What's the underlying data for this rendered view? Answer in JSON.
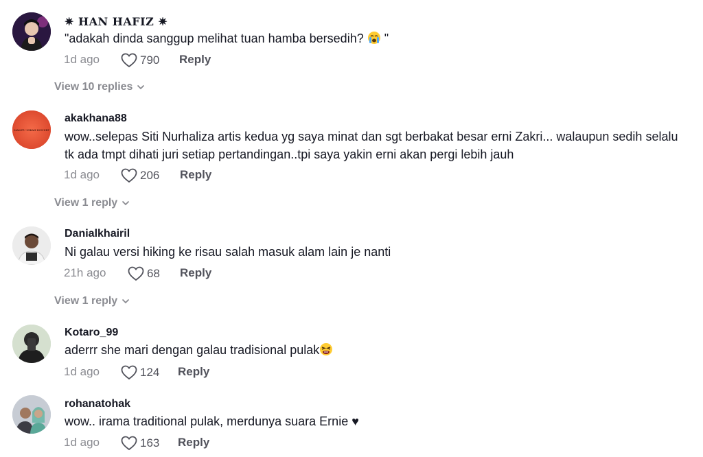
{
  "comments": [
    {
      "username": "✷ HAN HAFIZ ✷",
      "text": "\"adakah dinda sanggup melihat tuan hamba bersedih? ",
      "text_after": " \"",
      "emoji": "crying-face",
      "time": "1d ago",
      "likes": "790",
      "reply_label": "Reply",
      "view_replies": "View 10 replies",
      "avatar_colors": [
        "#3b1e5a",
        "#d94fb8"
      ]
    },
    {
      "username": "akakhana88",
      "text": "wow..selepas Siti Nurhaliza artis kedua yg saya minat dan sgt berbakat besar erni Zakri... walaupun sedih selalu tk ada tmpt dihati juri setiap pertandingan..tpi saya yakin erni akan pergi lebih jauh",
      "time": "1d ago",
      "likes": "206",
      "reply_label": "Reply",
      "view_replies": "View 1 reply",
      "avatar_text": "MAMPU NIKAH KONSEP",
      "avatar_colors": [
        "#d9442a",
        "#f25a3a"
      ]
    },
    {
      "username": "Danialkhairil",
      "text": "Ni galau versi hiking ke risau salah masuk alam lain je nanti",
      "time": "21h ago",
      "likes": "68",
      "reply_label": "Reply",
      "view_replies": "View 1 reply",
      "avatar_colors": [
        "#e8e8e8",
        "#3a2a22"
      ]
    },
    {
      "username": "Kotaro_99",
      "text": "aderrr she mari dengan galau tradisional pulak",
      "emoji": "tired-face",
      "time": "1d ago",
      "likes": "124",
      "reply_label": "Reply",
      "avatar_colors": [
        "#c9d7c2",
        "#2b2b2b"
      ]
    },
    {
      "username": "rohanatohak",
      "text": "wow.. irama traditional pulak, merdunya suara Ernie ♥",
      "time": "1d ago",
      "likes": "163",
      "reply_label": "Reply",
      "avatar_colors": [
        "#bfc7d3",
        "#4a3a30"
      ]
    }
  ],
  "icons": {
    "like": "heart-outline-icon",
    "expand": "chevron-down-icon"
  }
}
